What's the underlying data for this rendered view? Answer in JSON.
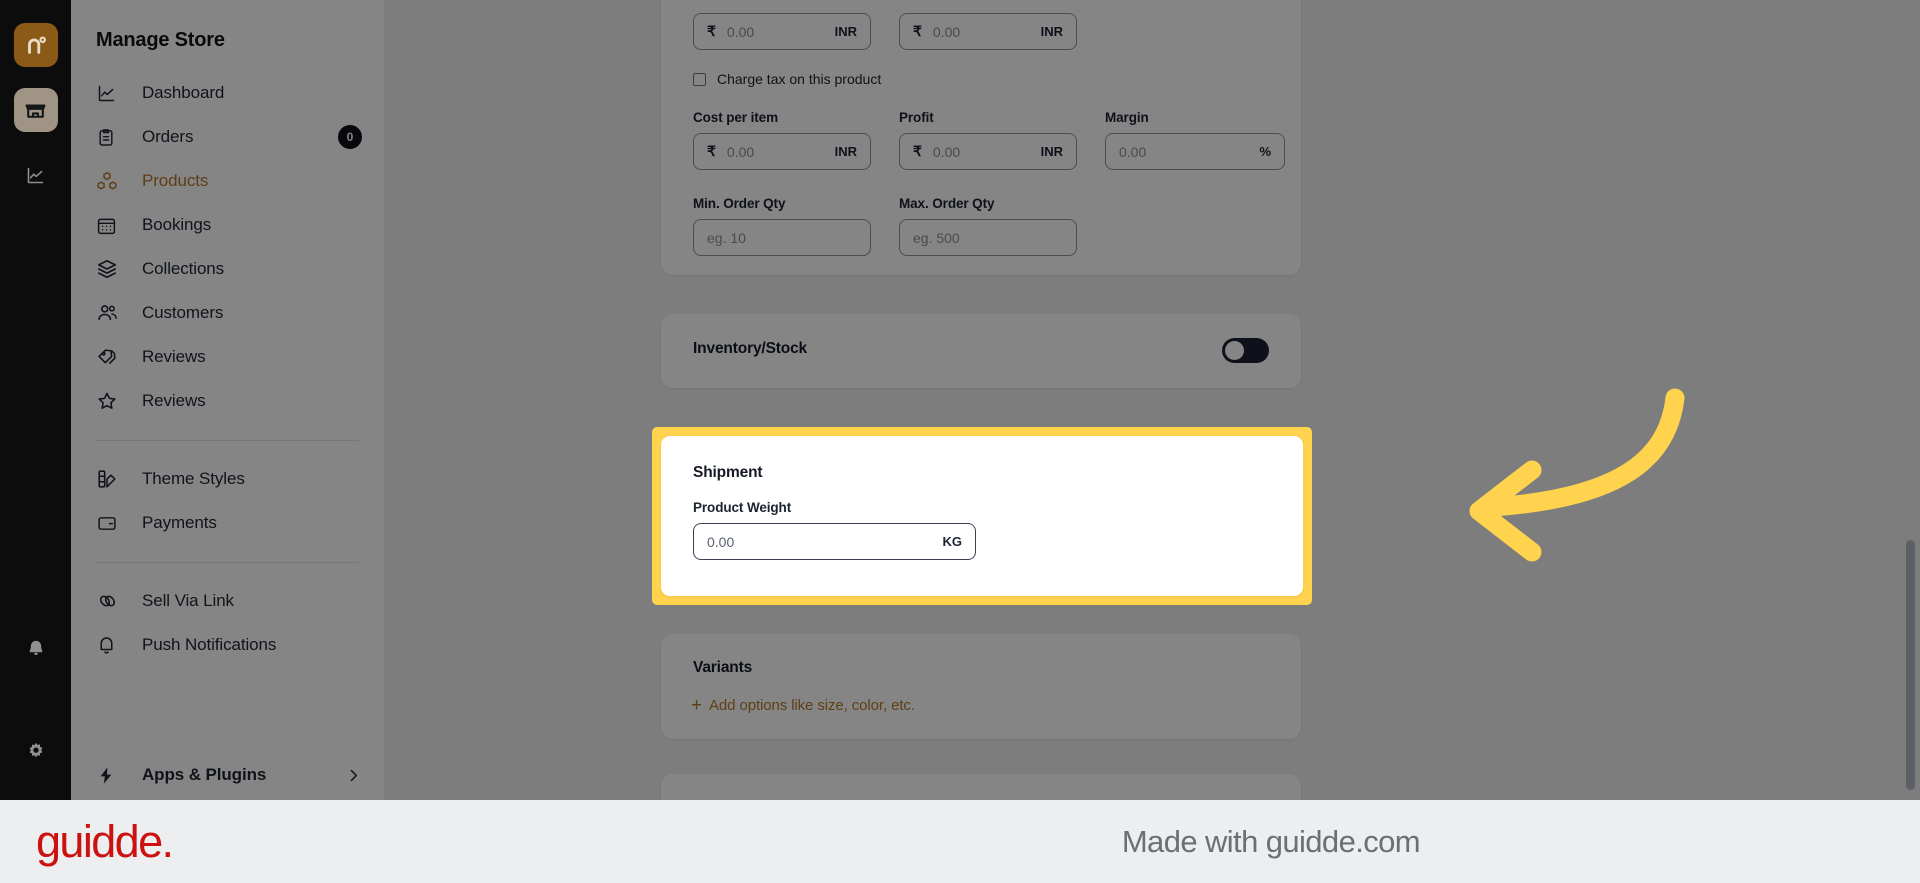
{
  "colors": {
    "brand_orange": "#b5792a",
    "rail_brand_tile": "#8a5a16",
    "rail_store_tile": "#a09484",
    "highlight_yellow": "#ffd34e",
    "guidde_red": "#cc1111",
    "dim_overlay": "rgba(0,0,0,0.48)",
    "toggle_off": "#1b2232"
  },
  "icon_rail": {
    "items": [
      {
        "name": "brand-logo-tile",
        "glyph": "n°"
      },
      {
        "name": "store-tile",
        "glyph": "store"
      },
      {
        "name": "analytics-tile",
        "glyph": "chart"
      }
    ],
    "bottom": [
      {
        "name": "notifications-bell",
        "glyph": "bell"
      },
      {
        "name": "settings-gear",
        "glyph": "gear"
      }
    ]
  },
  "sidebar": {
    "title": "Manage Store",
    "items": [
      {
        "label": "Dashboard",
        "icon": "chart-line-icon",
        "active": false,
        "badge": null
      },
      {
        "label": "Orders",
        "icon": "clipboard-icon",
        "active": false,
        "badge": "0"
      },
      {
        "label": "Products",
        "icon": "boxes-icon",
        "active": true,
        "badge": null
      },
      {
        "label": "Bookings",
        "icon": "calendar-icon",
        "active": false,
        "badge": null
      },
      {
        "label": "Collections",
        "icon": "layers-icon",
        "active": false,
        "badge": null
      },
      {
        "label": "Customers",
        "icon": "users-icon",
        "active": false,
        "badge": null
      },
      {
        "label": "Reviews",
        "icon": "star-icon",
        "active": false,
        "badge": null
      }
    ],
    "items_group2": [
      {
        "label": "Theme Styles",
        "icon": "palette-icon"
      },
      {
        "label": "Payments",
        "icon": "wallet-icon"
      }
    ],
    "items_group3": [
      {
        "label": "Sell Via Link",
        "icon": "link-icon"
      },
      {
        "label": "Push Notifications",
        "icon": "bell-icon"
      }
    ],
    "bottom_item": {
      "label": "Apps & Plugins",
      "icon": "bolt-icon",
      "chevron": "chevron-right-icon"
    }
  },
  "pricing_card": {
    "price_value": "0.00",
    "price_currency_symbol": "₹",
    "price_currency_code": "INR",
    "compare_value": "0.00",
    "compare_currency_symbol": "₹",
    "compare_currency_code": "INR",
    "tax_checkbox_label": "Charge tax on this product",
    "tax_checked": false,
    "cost_label": "Cost per item",
    "cost_value": "0.00",
    "cost_currency_symbol": "₹",
    "cost_currency_code": "INR",
    "profit_label": "Profit",
    "profit_value": "0.00",
    "profit_currency_symbol": "₹",
    "profit_currency_code": "INR",
    "margin_label": "Margin",
    "margin_value": "0.00",
    "margin_suffix": "%",
    "min_qty_label": "Min. Order Qty",
    "min_qty_placeholder": "eg. 10",
    "max_qty_label": "Max. Order Qty",
    "max_qty_placeholder": "eg. 500"
  },
  "inventory_card": {
    "title": "Inventory/Stock",
    "toggle_state": "off"
  },
  "shipment_card": {
    "title": "Shipment",
    "weight_label": "Product Weight",
    "weight_placeholder": "0.00",
    "weight_unit": "KG",
    "highlighted": true
  },
  "variants_card": {
    "title": "Variants",
    "add_option_label": "Add options like size, color, etc.",
    "add_option_plus": "+"
  },
  "annotation": {
    "arrow": "curved-left-arrow",
    "arrow_color": "#ffd34e"
  },
  "footer": {
    "logo_text": "guidde.",
    "made_with": "Made with guidde.com"
  }
}
